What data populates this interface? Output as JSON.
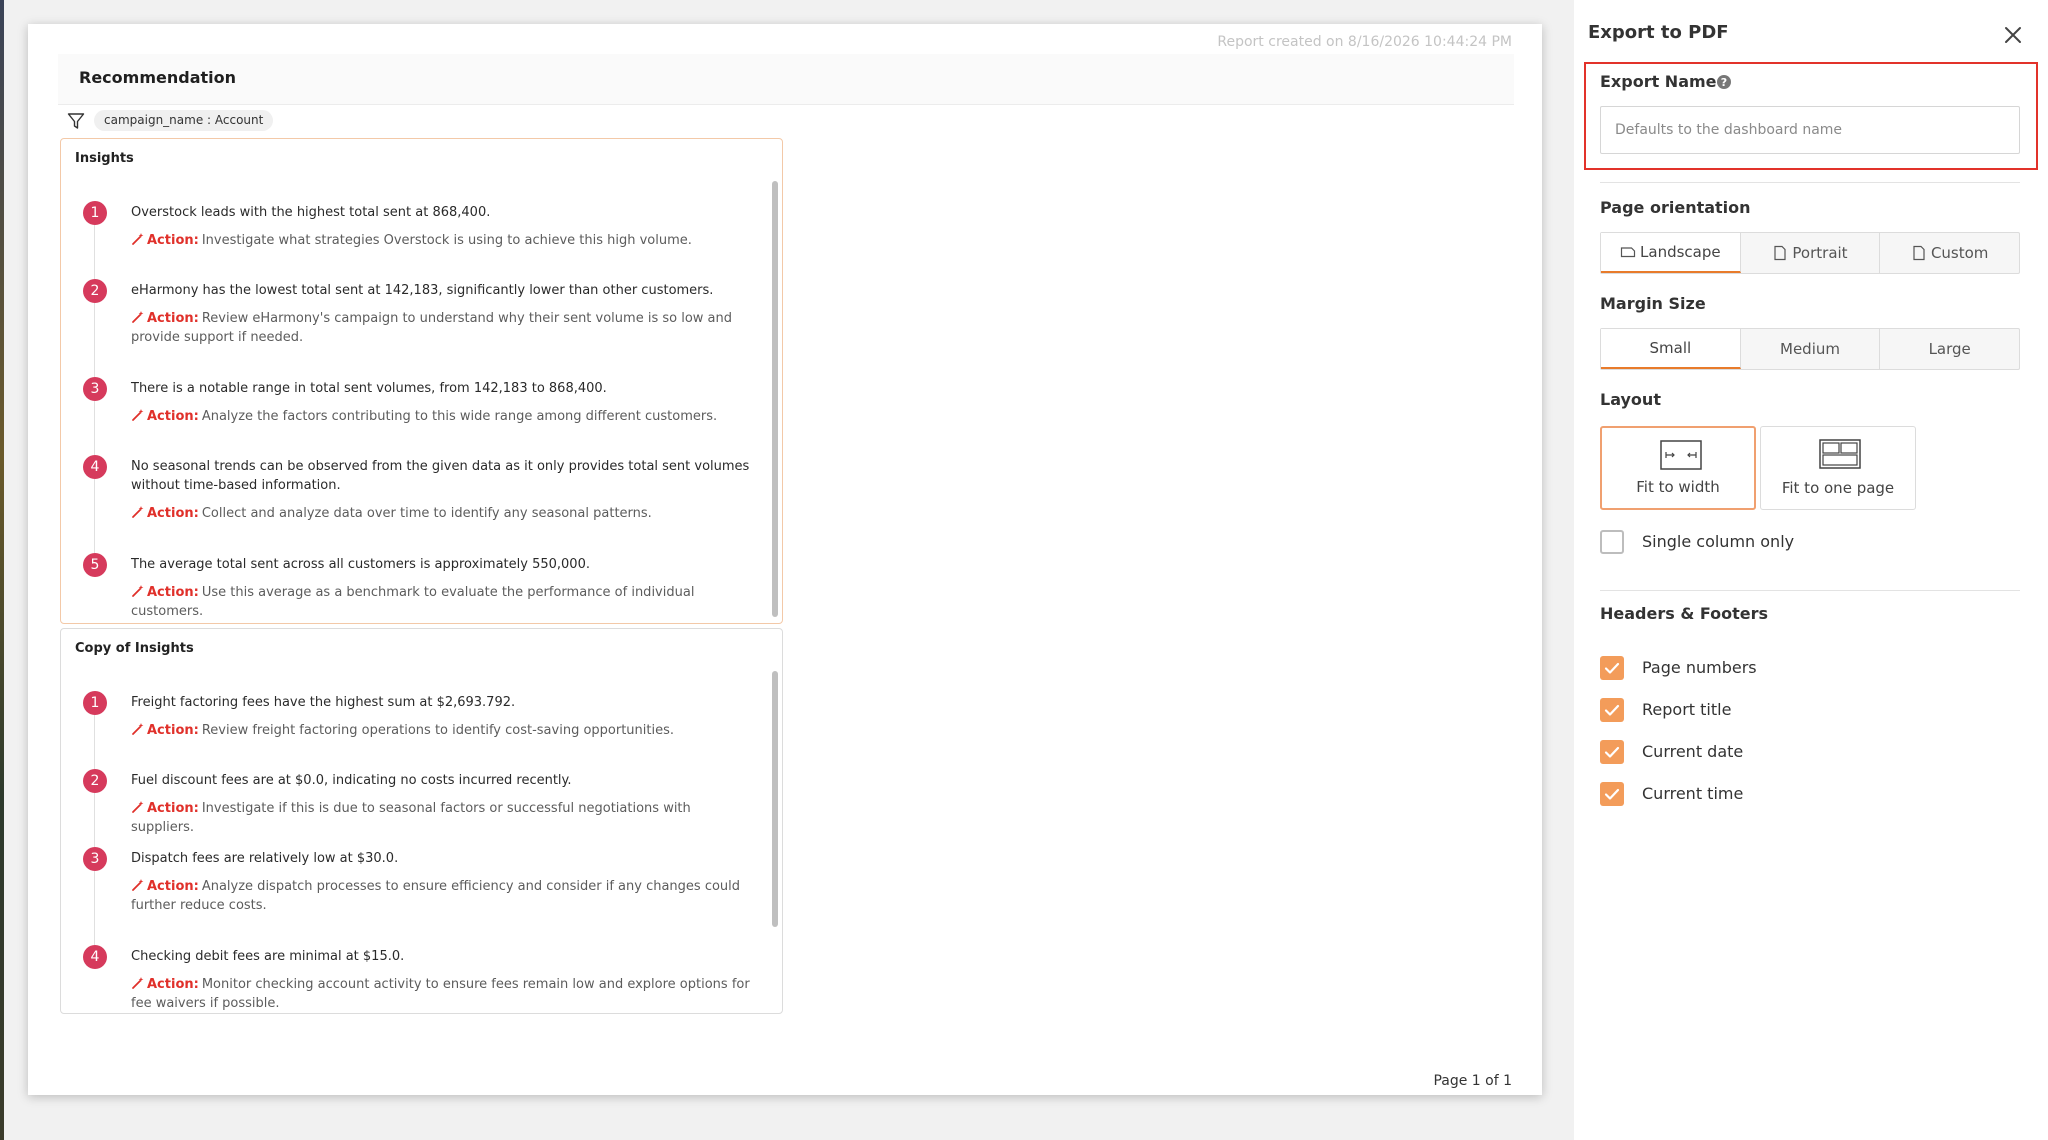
{
  "report": {
    "created": "Report created on 8/16/2026 10:44:24 PM",
    "page_number": "Page 1 of 1"
  },
  "dashboard": {
    "title": "Recommendation",
    "filter_chip": "campaign_name : Account"
  },
  "action_label": "Action:",
  "cards": [
    {
      "title": "Insights",
      "items": [
        {
          "num": "1",
          "text": "Overstock leads with the highest total sent at 868,400.",
          "action": "Investigate what strategies Overstock is using to achieve this high volume."
        },
        {
          "num": "2",
          "text": "eHarmony has the lowest total sent at 142,183, significantly lower than other customers.",
          "action": "Review eHarmony's campaign to understand why their sent volume is so low and provide support if needed."
        },
        {
          "num": "3",
          "text": "There is a notable range in total sent volumes, from 142,183 to 868,400.",
          "action": "Analyze the factors contributing to this wide range among different customers."
        },
        {
          "num": "4",
          "text": "No seasonal trends can be observed from the given data as it only provides total sent volumes without time-based information.",
          "action": "Collect and analyze data over time to identify any seasonal patterns."
        },
        {
          "num": "5",
          "text": "The average total sent across all customers is approximately 550,000.",
          "action": "Use this average as a benchmark to evaluate the performance of individual customers."
        }
      ]
    },
    {
      "title": "Copy of Insights",
      "items": [
        {
          "num": "1",
          "text": "Freight factoring fees have the highest sum at $2,693.792.",
          "action": "Review freight factoring operations to identify cost-saving opportunities."
        },
        {
          "num": "2",
          "text": "Fuel discount fees are at $0.0, indicating no costs incurred recently.",
          "action": "Investigate if this is due to seasonal factors or successful negotiations with suppliers."
        },
        {
          "num": "3",
          "text": "Dispatch fees are relatively low at $30.0.",
          "action": "Analyze dispatch processes to ensure efficiency and consider if any changes could further reduce costs."
        },
        {
          "num": "4",
          "text": "Checking debit fees are minimal at $15.0.",
          "action": "Monitor checking account activity to ensure fees remain low and explore options for fee waivers if possible."
        }
      ]
    }
  ],
  "panel": {
    "title": "Export to PDF",
    "export_name_label": "Export Name",
    "export_name_placeholder": "Defaults to the dashboard name",
    "export_name_value": "",
    "orientation_label": "Page orientation",
    "orientations": [
      "Landscape",
      "Portrait",
      "Custom"
    ],
    "orientation_selected": "Landscape",
    "margin_label": "Margin Size",
    "margins": [
      "Small",
      "Medium",
      "Large"
    ],
    "margin_selected": "Small",
    "layout_label": "Layout",
    "layouts": [
      "Fit to width",
      "Fit to one page"
    ],
    "layout_selected": "Fit to width",
    "single_column_label": "Single column only",
    "single_column_checked": false,
    "hf_label": "Headers & Footers",
    "hf_options": [
      {
        "label": "Page numbers",
        "checked": true
      },
      {
        "label": "Report title",
        "checked": true
      },
      {
        "label": "Current date",
        "checked": true
      },
      {
        "label": "Current time",
        "checked": true
      }
    ]
  },
  "colors": {
    "accent": "#f39c5a",
    "highlight": "#e2322a",
    "badge": "#d63a5c",
    "action": "#e0302a"
  },
  "icons": {
    "filter": "filter-icon",
    "close": "close-icon",
    "help": "help-icon",
    "action": "magic-wand-icon",
    "landscape": "landscape-page-icon",
    "portrait": "portrait-page-icon",
    "custom": "custom-page-icon",
    "fit_width": "fit-to-width-icon",
    "fit_page": "fit-to-one-page-icon",
    "check": "check-icon"
  }
}
